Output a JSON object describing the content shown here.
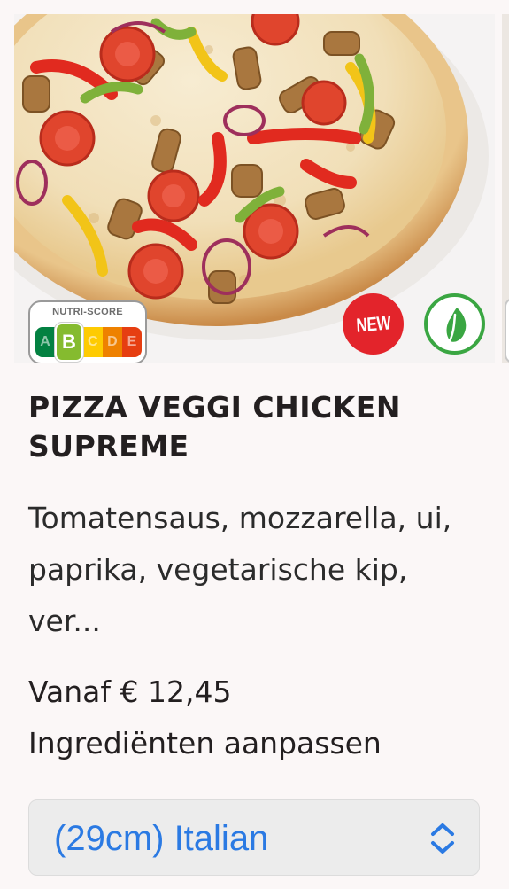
{
  "product": {
    "title": "PIZZA VEGGI CHICKEN SUPREME",
    "description": "Tomatensaus, mozzarella, ui, paprika, vegetarische kip, ver...",
    "price": "Vanaf € 12,45",
    "customize_label": "Ingrediënten aanpassen"
  },
  "nutri_score": {
    "title": "NUTRI-SCORE",
    "grades": [
      "A",
      "B",
      "C",
      "D",
      "E"
    ],
    "colors": [
      "#038141",
      "#85bb2f",
      "#fecb02",
      "#ee8100",
      "#e63e11"
    ],
    "selected": "B"
  },
  "badges": {
    "new_label": "NEW",
    "new_color": "#e3242b",
    "vegetarian_icon": "leaf-icon",
    "vegetarian_color": "#3aa642"
  },
  "size_select": {
    "value": "(29cm) Italian",
    "color": "#2b7ae3",
    "icon": "chevron-updown-icon"
  }
}
